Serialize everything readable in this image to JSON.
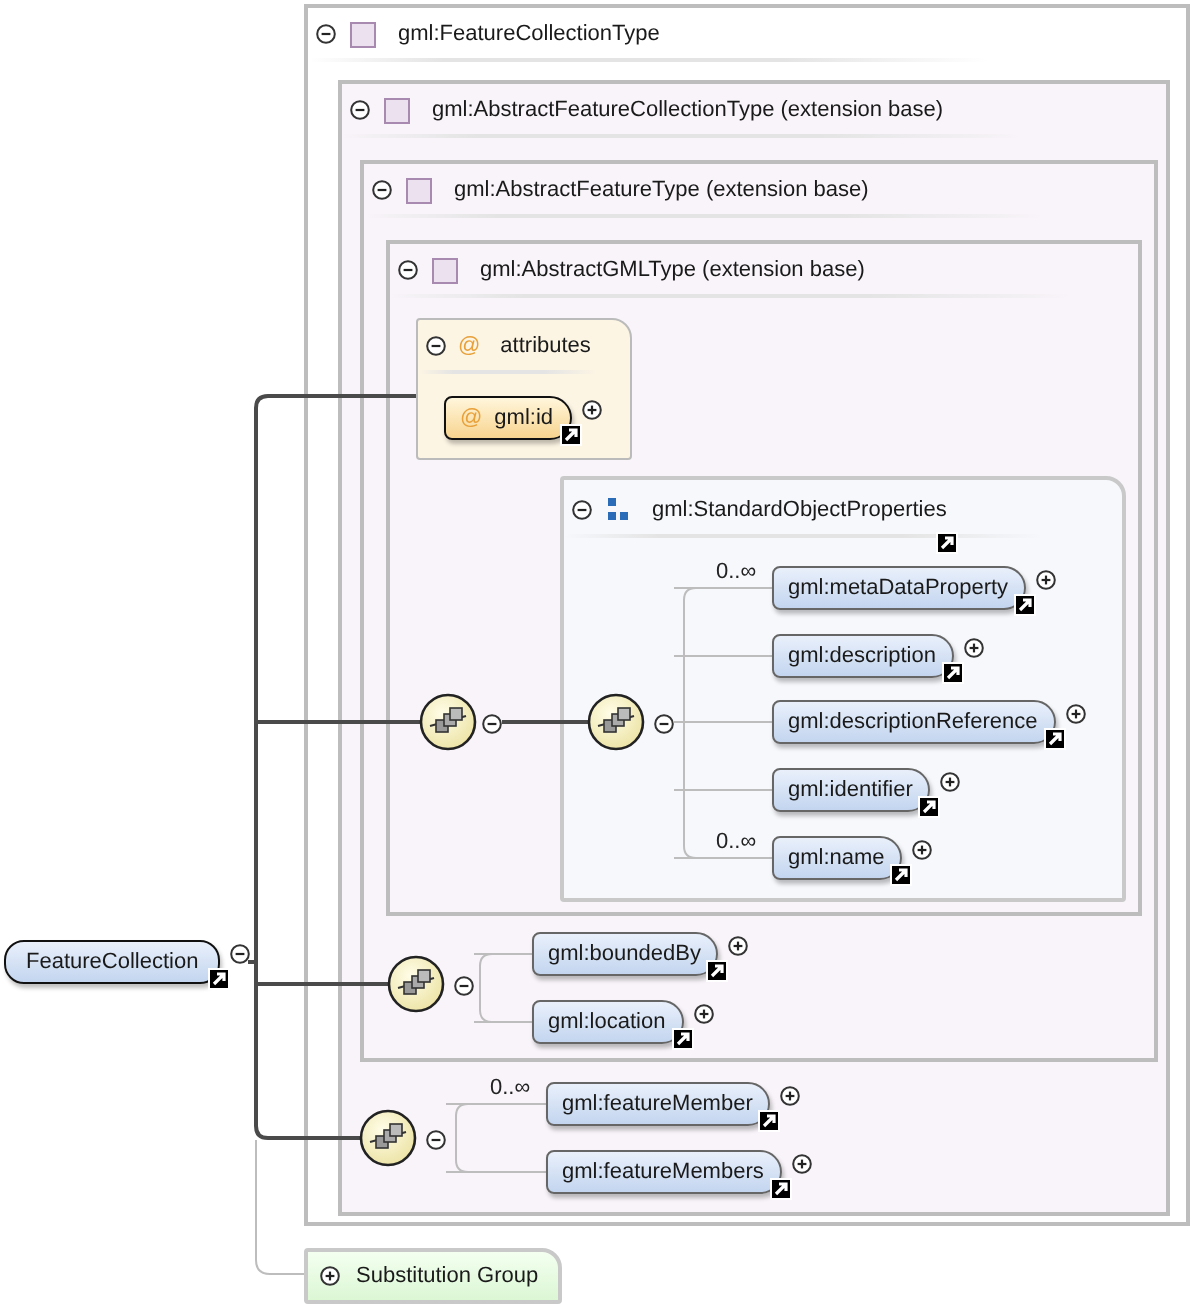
{
  "element": {
    "name": "FeatureCollection",
    "expanded": true
  },
  "complex_type": {
    "name": "gml:FeatureCollectionType",
    "expanded": true
  },
  "base_types": [
    {
      "name": "gml:AbstractFeatureCollectionType (extension base)",
      "expanded": true
    },
    {
      "name": "gml:AbstractFeatureType (extension base)",
      "expanded": true
    },
    {
      "name": "gml:AbstractGMLType (extension base)",
      "expanded": true
    }
  ],
  "attributes": {
    "icon": "@",
    "label": "attributes",
    "expanded": true,
    "items": [
      {
        "icon": "@",
        "name": "gml:id",
        "expanded": false
      }
    ]
  },
  "sequences": [
    {
      "expanded": true,
      "group": {
        "name": "gml:StandardObjectProperties",
        "expanded": true,
        "sequence_expanded": true,
        "children": [
          {
            "name": "gml:metaDataProperty",
            "occurs": "0..∞",
            "expanded": false
          },
          {
            "name": "gml:description",
            "expanded": false
          },
          {
            "name": "gml:descriptionReference",
            "expanded": false
          },
          {
            "name": "gml:identifier",
            "expanded": false
          },
          {
            "name": "gml:name",
            "occurs": "0..∞",
            "expanded": false
          }
        ]
      }
    },
    {
      "expanded": true,
      "children": [
        {
          "name": "gml:boundedBy",
          "expanded": false
        },
        {
          "name": "gml:location",
          "expanded": false
        }
      ]
    },
    {
      "expanded": true,
      "children": [
        {
          "name": "gml:featureMember",
          "occurs": "0..∞",
          "expanded": false
        },
        {
          "name": "gml:featureMembers",
          "expanded": false
        }
      ]
    }
  ],
  "substitution_group": {
    "label": "Substitution Group",
    "expanded": false
  }
}
